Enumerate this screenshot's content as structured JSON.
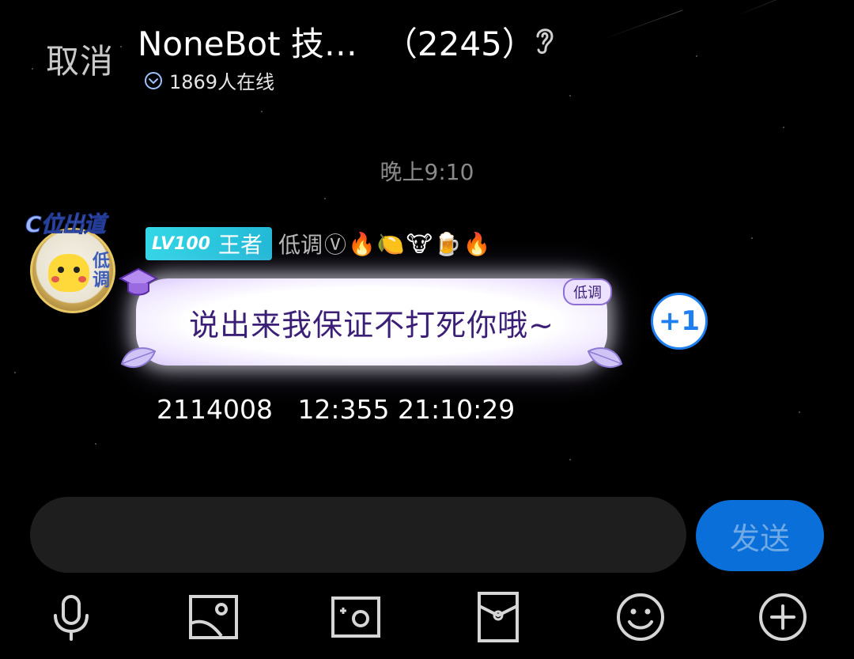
{
  "header": {
    "cancel_label": "取消",
    "group_name": "NoneBot 技…",
    "member_count": "（2245）",
    "online_text": "1869人在线"
  },
  "chat": {
    "time_divider": "晚上9:10",
    "message": {
      "level_label": "LV100",
      "title_badge": "王者",
      "sender_name": "低调",
      "sender_emojis": [
        "Ⓥ",
        "🔥",
        "🍋",
        "🐮",
        "🍺",
        "🔥"
      ],
      "text": "说出来我保证不打死你哦~",
      "bubble_tag": "低调",
      "avatar_text": "低调",
      "avatar_deco_text": "C位出道",
      "plus_one": "+1",
      "meta_line": "2114008   12:355 21:10:29"
    }
  },
  "composer": {
    "input_value": "",
    "send_label": "发送"
  },
  "toolbar": {
    "icons": [
      "microphone-icon",
      "image-icon",
      "camera-icon",
      "red-packet-icon",
      "emoji-icon",
      "plus-icon"
    ]
  },
  "colors": {
    "accent_blue": "#0a6fd8",
    "badge_cyan": "#2ccbe0",
    "bubble_text": "#3b1f77"
  }
}
